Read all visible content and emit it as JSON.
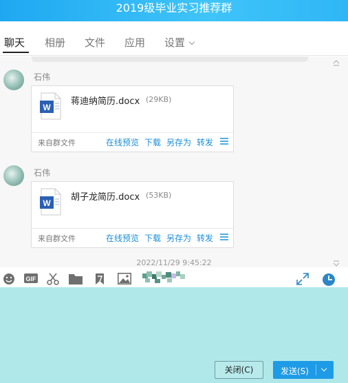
{
  "window": {
    "title": "2019级毕业实习推荐群"
  },
  "tabs": [
    {
      "label": "聊天",
      "active": true
    },
    {
      "label": "相册"
    },
    {
      "label": "文件"
    },
    {
      "label": "应用"
    },
    {
      "label": "设置"
    }
  ],
  "messages": [
    {
      "sender": "石伟",
      "file": {
        "name": "蒋迪纳简历.docx",
        "size": "(29KB)",
        "type_icon": "word-document-icon"
      },
      "source": "来自群文件",
      "actions": [
        "在线预览",
        "下载",
        "另存为",
        "转发"
      ]
    },
    {
      "sender": "石伟",
      "file": {
        "name": "胡子龙简历.docx",
        "size": "(53KB)",
        "type_icon": "word-document-icon"
      },
      "source": "来自群文件",
      "actions": [
        "在线预览",
        "下载",
        "另存为",
        "转发"
      ]
    }
  ],
  "timestamp": "2022/11/29 9:45:22",
  "toolbar": {
    "icons": [
      "emoji-icon",
      "gif-icon",
      "screenshot-scissors-icon",
      "folder-icon",
      "bookmark-icon",
      "image-icon",
      "sticker-icon",
      "expand-icon",
      "history-clock-icon"
    ]
  },
  "footer": {
    "close_label": "关闭(C)",
    "send_label": "发送(S)"
  },
  "colors": {
    "title_bar": "#2fb6f6",
    "link": "#1a8fd9",
    "input_bg": "#b0e8ea",
    "send_button": "#1e9be6",
    "word_blue": "#2b5fb4"
  }
}
